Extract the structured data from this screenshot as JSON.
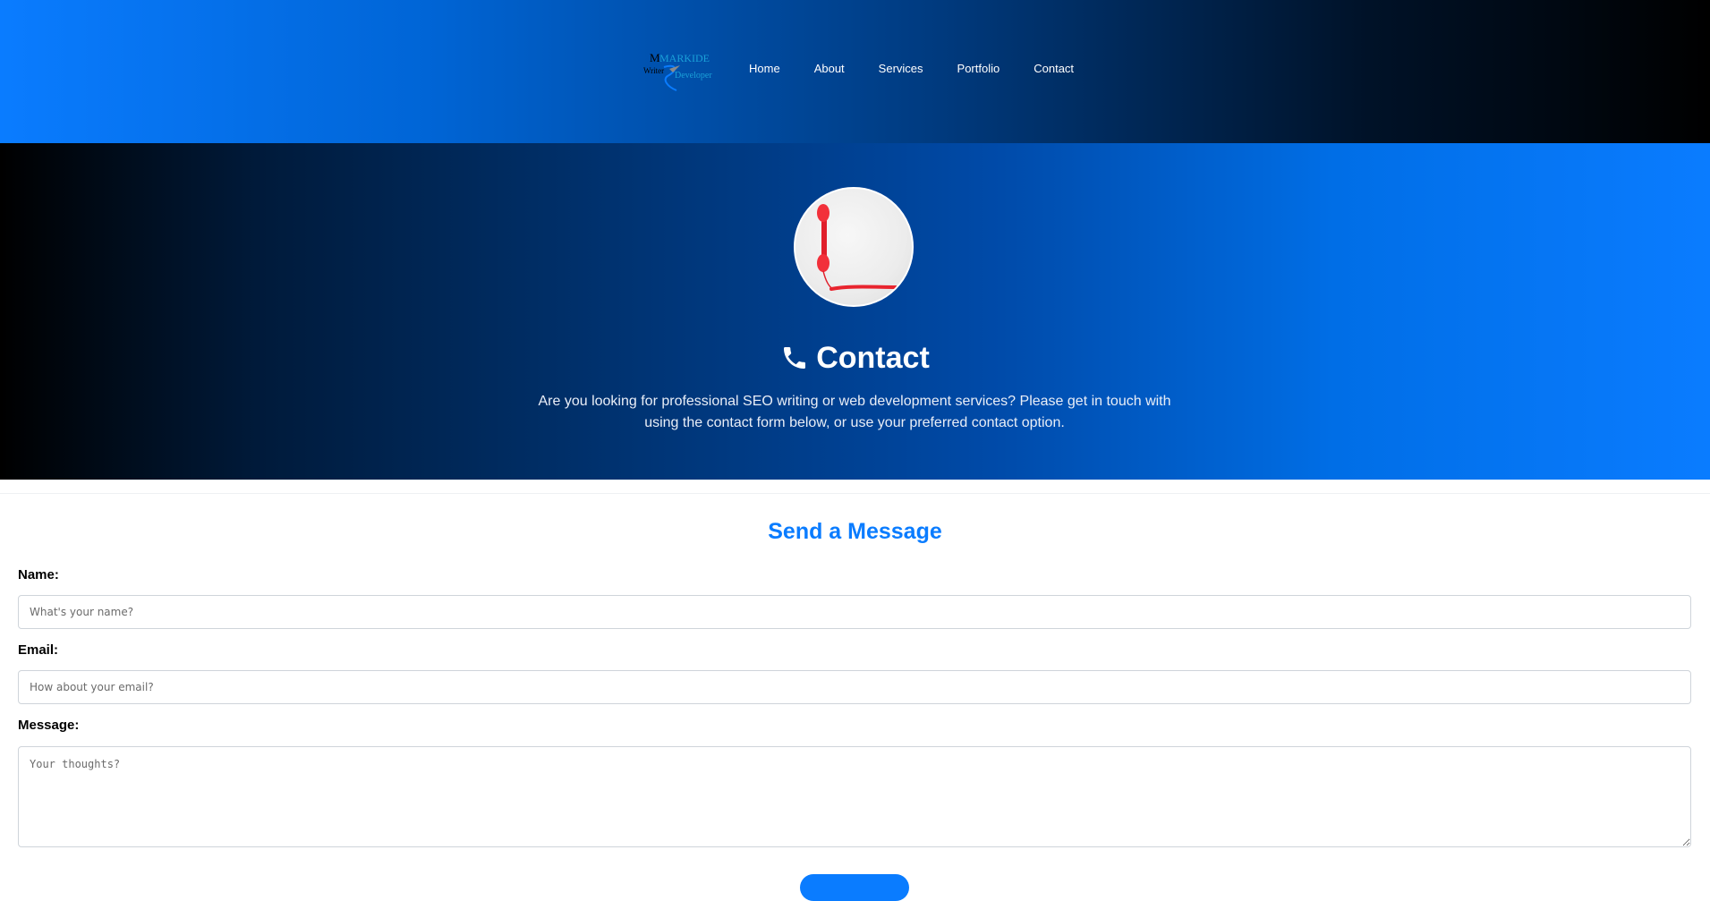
{
  "header": {
    "logo": {
      "line1": "MARKIDE",
      "line2a": "Writer",
      "line2b": "Developer"
    },
    "nav": [
      {
        "label": "Home"
      },
      {
        "label": "About"
      },
      {
        "label": "Services"
      },
      {
        "label": "Portfolio"
      },
      {
        "label": "Contact"
      }
    ]
  },
  "hero": {
    "title": "Contact",
    "title_icon": "phone-icon",
    "description": "Are you looking for professional SEO writing or web development services? Please get in touch with using the contact form below, or use your preferred contact option."
  },
  "form": {
    "title": "Send a Message",
    "name_label": "Name:",
    "name_placeholder": "What's your name?",
    "email_label": "Email:",
    "email_placeholder": "How about your email?",
    "message_label": "Message:",
    "message_placeholder": "Your thoughts?"
  },
  "colors": {
    "accent": "#0a7cff",
    "header_gradient_start": "#0a7cff",
    "header_gradient_end": "#000000"
  }
}
